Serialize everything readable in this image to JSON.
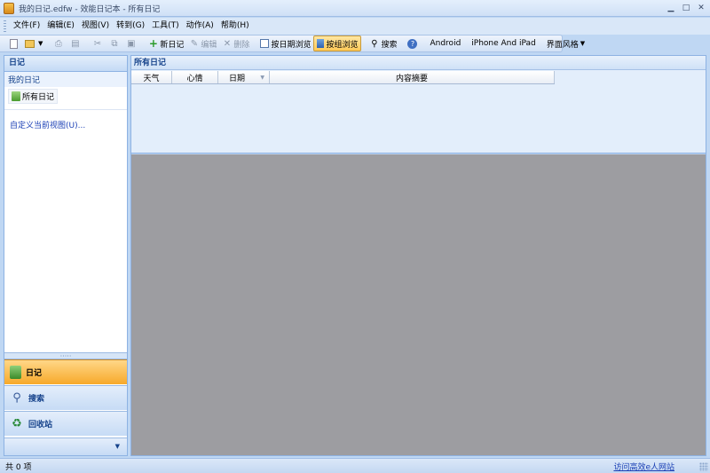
{
  "window": {
    "title": "我的日记.edfw - 效能日记本 - 所有日记",
    "app_icon": "diary-icon"
  },
  "menu": [
    "文件(F)",
    "编辑(E)",
    "视图(V)",
    "转到(G)",
    "工具(T)",
    "动作(A)",
    "帮助(H)"
  ],
  "toolbar": {
    "new_diary": "新日记",
    "edit": "编辑",
    "delete": "删除",
    "browse_by_date": "按日期浏览",
    "browse_by_group": "按组浏览",
    "search": "搜索",
    "android": "Android",
    "iphone_ipad": "iPhone And iPad",
    "ui_style": "界面风格"
  },
  "left_pane": {
    "header": "日记",
    "section": "我的日记",
    "tree_item": "所有日记",
    "customize_link": "自定义当前视图(U)...",
    "splitter_dots": "·····",
    "nav": {
      "diary": "日记",
      "search": "搜索",
      "recycle": "回收站"
    }
  },
  "list": {
    "title": "所有日记",
    "columns": [
      "天气",
      "心情",
      "日期",
      "内容摘要"
    ]
  },
  "status": {
    "count": "共 0 项",
    "link": "访问高效e人网站"
  },
  "colors": {
    "accent": "#f7a92a",
    "frame": "#bfd7f3",
    "link": "#1a3fb5"
  }
}
